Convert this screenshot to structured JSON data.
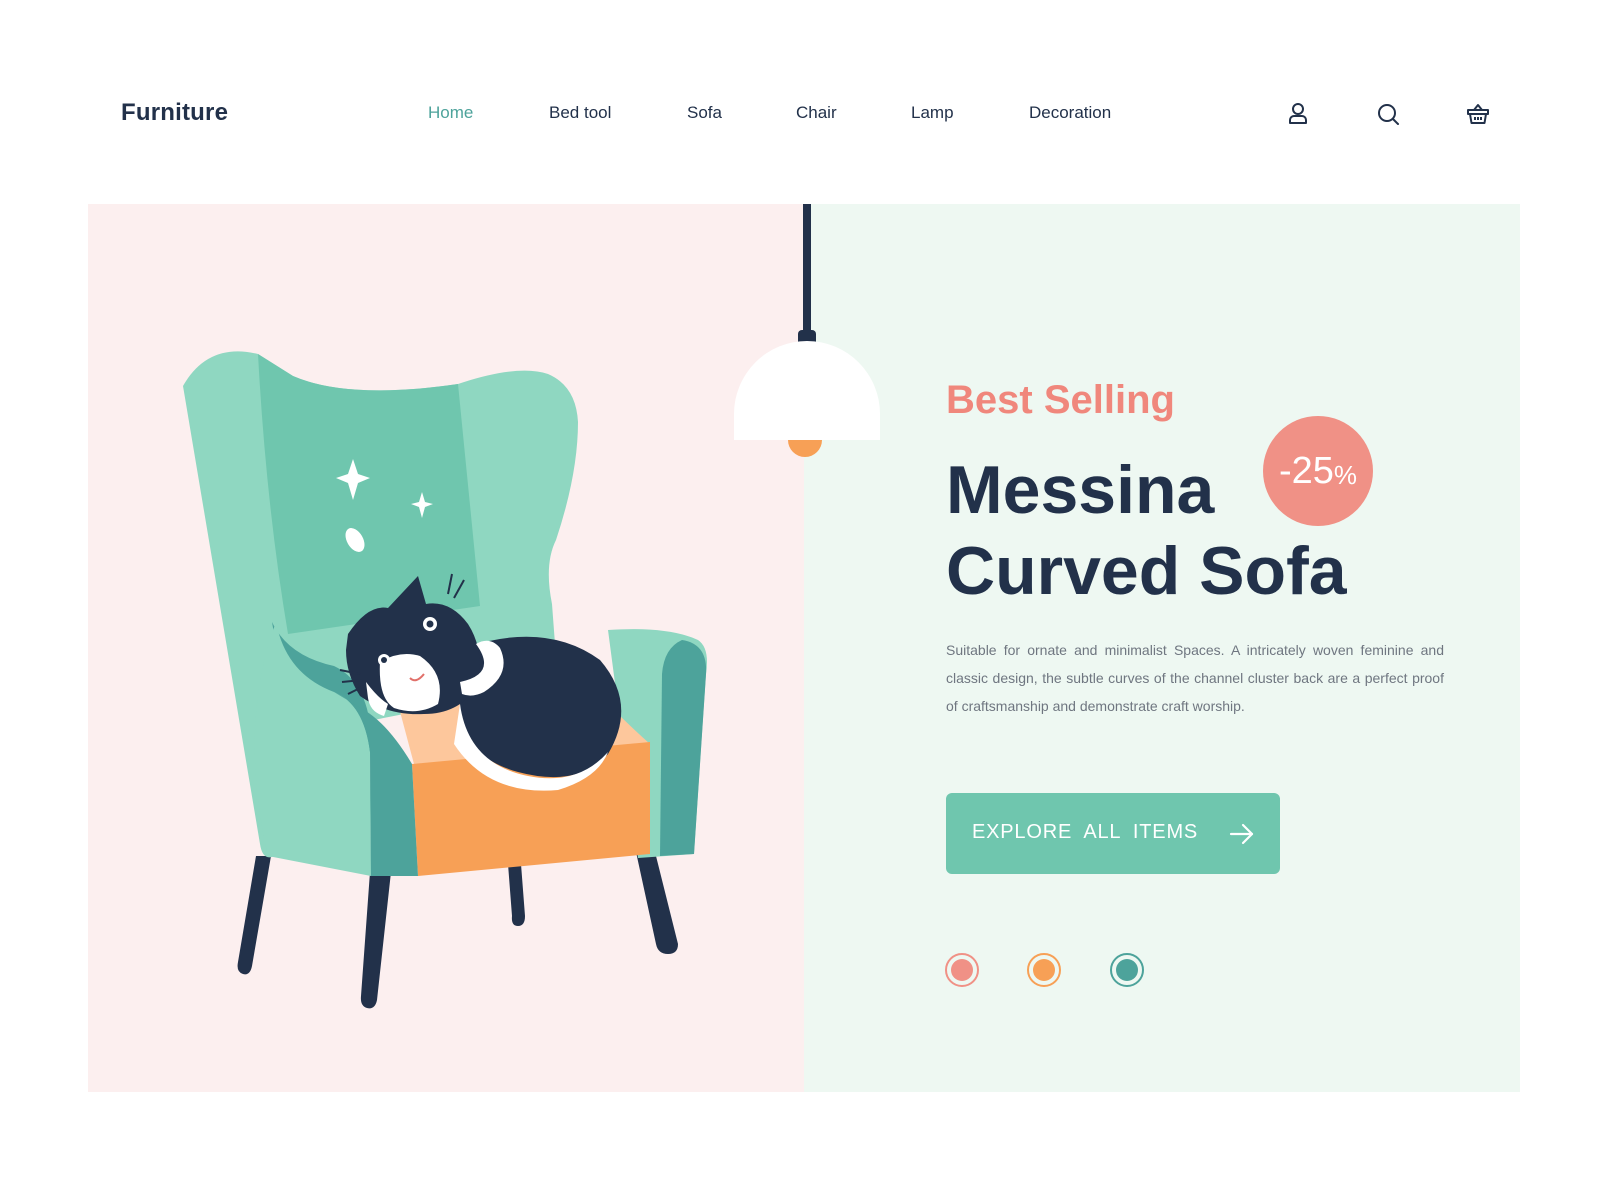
{
  "header": {
    "logo": "Furniture",
    "nav": [
      {
        "label": "Home",
        "active": true
      },
      {
        "label": "Bed tool",
        "active": false
      },
      {
        "label": "Sofa",
        "active": false
      },
      {
        "label": "Chair",
        "active": false
      },
      {
        "label": "Lamp",
        "active": false
      },
      {
        "label": "Decoration",
        "active": false
      }
    ],
    "icons": [
      "user-icon",
      "search-icon",
      "basket-icon"
    ]
  },
  "hero": {
    "eyebrow": "Best Selling",
    "title_line1": "Messina",
    "title_line2": "Curved Sofa",
    "discount": {
      "value": "-25",
      "unit": "%"
    },
    "description": "Suitable for ornate and minimalist Spaces. A intricately woven feminine and classic design, the subtle curves of the channel cluster back are a perfect proof of craftsmanship and demonstrate craft worship.",
    "cta_label": "EXPLORE ALL ITEMS",
    "color_options": [
      "#f09186",
      "#f7a056",
      "#4da39b"
    ]
  },
  "colors": {
    "accent": "#4da39b",
    "brand_dark": "#22314a",
    "coral": "#f0877c",
    "button": "#6fc6ae",
    "panel_pink": "#fcefef",
    "panel_mint": "#eef8f2"
  }
}
